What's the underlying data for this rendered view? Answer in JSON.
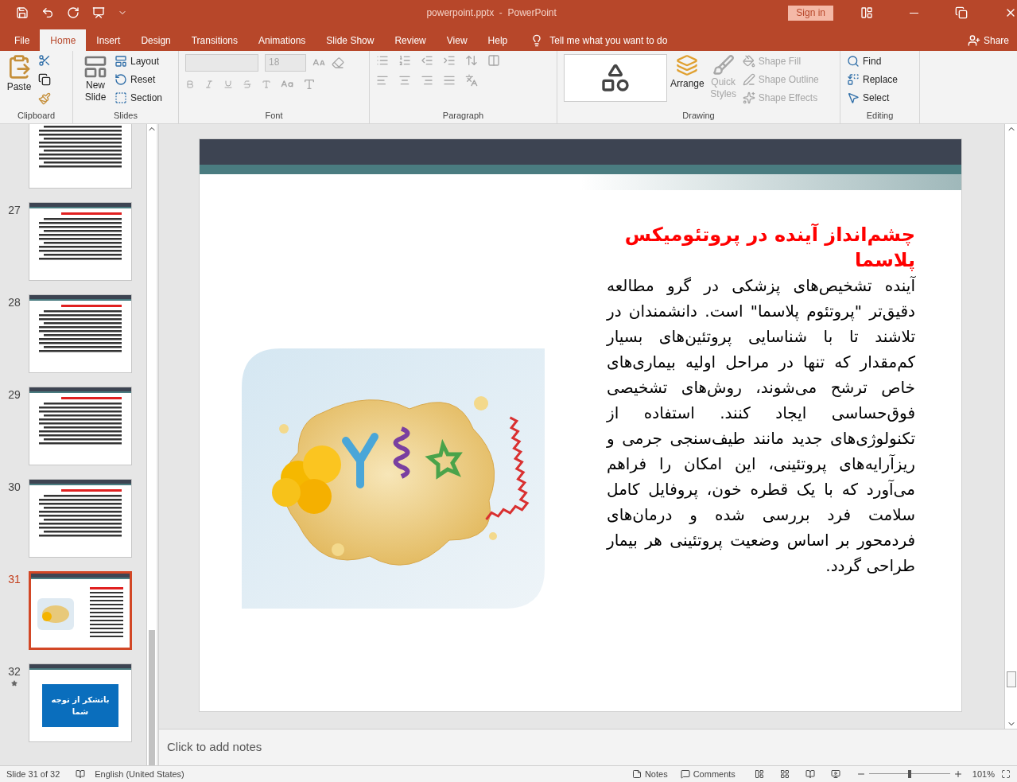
{
  "window": {
    "title": "powerpoint.pptx  -  PowerPoint",
    "sign_in": "Sign in"
  },
  "tabs": [
    {
      "label": "File",
      "selected": false
    },
    {
      "label": "Home",
      "selected": true
    },
    {
      "label": "Insert",
      "selected": false
    },
    {
      "label": "Design",
      "selected": false
    },
    {
      "label": "Transitions",
      "selected": false
    },
    {
      "label": "Animations",
      "selected": false
    },
    {
      "label": "Slide Show",
      "selected": false
    },
    {
      "label": "Review",
      "selected": false
    },
    {
      "label": "View",
      "selected": false
    },
    {
      "label": "Help",
      "selected": false
    }
  ],
  "tell_me": "Tell me what you want to do",
  "share": "Share",
  "ribbon": {
    "clipboard": {
      "label": "Clipboard",
      "paste": "Paste"
    },
    "slides": {
      "label": "Slides",
      "new_slide": "New Slide",
      "items": [
        "Layout",
        "Reset",
        "Section"
      ]
    },
    "font": {
      "label": "Font",
      "size": "18"
    },
    "paragraph": {
      "label": "Paragraph"
    },
    "drawing": {
      "label": "Drawing",
      "arrange": "Arrange",
      "quick_styles": {
        "label": "Quick Styles",
        "disabled": true
      },
      "items": [
        {
          "label": "Shape Fill",
          "disabled": true
        },
        {
          "label": "Shape Outline",
          "disabled": true
        },
        {
          "label": "Shape Effects",
          "disabled": true
        }
      ]
    },
    "editing": {
      "label": "Editing",
      "items": [
        {
          "label": "Find",
          "kind": "find"
        },
        {
          "label": "Replace",
          "kind": "replace"
        },
        {
          "label": "Select",
          "kind": "select"
        }
      ]
    }
  },
  "thumbnails": [
    {
      "kind": "text",
      "selected": false
    },
    {
      "number": "27",
      "kind": "text",
      "selected": false
    },
    {
      "number": "28",
      "kind": "text",
      "selected": false
    },
    {
      "number": "29",
      "kind": "text",
      "selected": false
    },
    {
      "number": "30",
      "kind": "text",
      "selected": false
    },
    {
      "number": "31",
      "kind": "image",
      "selected": true
    },
    {
      "number": "32",
      "kind": "thanks",
      "selected": false,
      "text": "باتشکر از توجه شما"
    }
  ],
  "slide": {
    "title": "چشم‌انداز آینده در پروتئومیکس پلاسما",
    "body": "آینده تشخیص‌های پزشکی در گرو مطالعه دقیق‌تر \"پروتئوم پلاسما\" است. دانشمندان در تلاشند تا با شناسایی پروتئین‌های بسیار کم‌مقدار که تنها در مراحل اولیه بیماری‌های خاص ترشح می‌شوند، روش‌های تشخیصی فوق‌حساسی ایجاد کنند. استفاده از تکنولوژی‌های جدید مانند طیف‌سنجی جرمی و ریزآرایه‌های پروتئینی، این امکان را فراهم می‌آورد که با یک قطره خون، پروفایل کامل سلامت فرد بررسی شده و درمان‌های فردمحور بر اساس وضعیت پروتئینی هر بیمار طراحی گردد."
  },
  "notes": {
    "placeholder": "Click to add notes"
  },
  "status": {
    "slide": "Slide 31 of 32",
    "language": "English (United States)",
    "notes": "Notes",
    "comments": "Comments",
    "zoom": "101%",
    "zoom_slider": {
      "level": 0.5
    }
  }
}
